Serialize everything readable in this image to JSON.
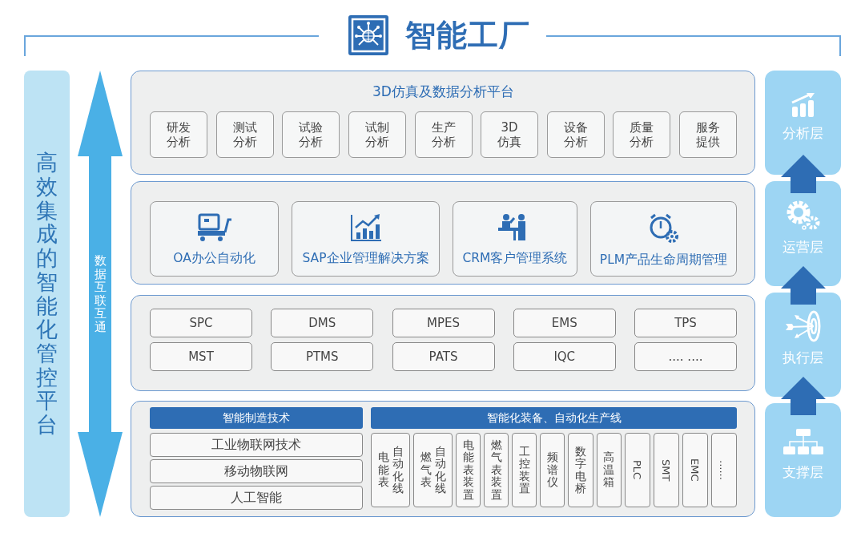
{
  "header": {
    "title": "智能工厂"
  },
  "platform": {
    "title": "高效集成的智能化管控平台"
  },
  "flow_arrow": {
    "label": "数据互联互通"
  },
  "analysis_panel": {
    "title": "3D仿真及数据分析平台",
    "items": [
      {
        "lines": [
          "研发",
          "分析"
        ]
      },
      {
        "lines": [
          "测试",
          "分析"
        ]
      },
      {
        "lines": [
          "试验",
          "分析"
        ]
      },
      {
        "lines": [
          "试制",
          "分析"
        ]
      },
      {
        "lines": [
          "生产",
          "分析"
        ]
      },
      {
        "lines": [
          "3D",
          "仿真"
        ]
      },
      {
        "lines": [
          "设备",
          "分析"
        ]
      },
      {
        "lines": [
          "质量",
          "分析"
        ]
      },
      {
        "lines": [
          "服务",
          "提供"
        ]
      }
    ]
  },
  "systems": [
    {
      "label": "OA办公自动化",
      "kind": "cart"
    },
    {
      "label": "SAP企业管理解决方案",
      "kind": "chart"
    },
    {
      "label": "CRM客户管理系统",
      "kind": "people"
    },
    {
      "label": "PLM产品生命周期管理",
      "kind": "clock"
    }
  ],
  "modules": [
    [
      "SPC",
      "DMS",
      "MPES",
      "EMS",
      "TPS"
    ],
    [
      "MST",
      "PTMS",
      "PATS",
      "IQC",
      ".... ...."
    ]
  ],
  "support": {
    "tech_title": "智能制造技术",
    "tech_items": [
      "工业物联网技术",
      "移动物联网",
      "人工智能"
    ],
    "equipment_title": "智能化装备、自动化生产线",
    "equipment": [
      {
        "kind": "vertical",
        "columns": [
          "电能表",
          "自动化线"
        ]
      },
      {
        "kind": "vertical",
        "columns": [
          "燃气表",
          "自动化线"
        ]
      },
      {
        "kind": "vertical",
        "columns": [
          "电能表装置"
        ]
      },
      {
        "kind": "vertical",
        "columns": [
          "燃气表装置"
        ]
      },
      {
        "kind": "vertical",
        "columns": [
          "工控装置"
        ]
      },
      {
        "kind": "vertical",
        "columns": [
          "频谱仪"
        ]
      },
      {
        "kind": "vertical",
        "columns": [
          "数字电桥"
        ]
      },
      {
        "kind": "vertical",
        "columns": [
          "高温箱"
        ]
      },
      {
        "kind": "rotated",
        "columns": [
          "PLC"
        ]
      },
      {
        "kind": "rotated",
        "columns": [
          "SMT"
        ]
      },
      {
        "kind": "rotated",
        "columns": [
          "EMC"
        ]
      },
      {
        "kind": "rotated",
        "columns": [
          "......"
        ]
      }
    ]
  },
  "layers": [
    {
      "label": "分析层",
      "kind": "chart"
    },
    {
      "label": "运营层",
      "kind": "gears"
    },
    {
      "label": "执行层",
      "kind": "target"
    },
    {
      "label": "支撑层",
      "kind": "org"
    }
  ]
}
